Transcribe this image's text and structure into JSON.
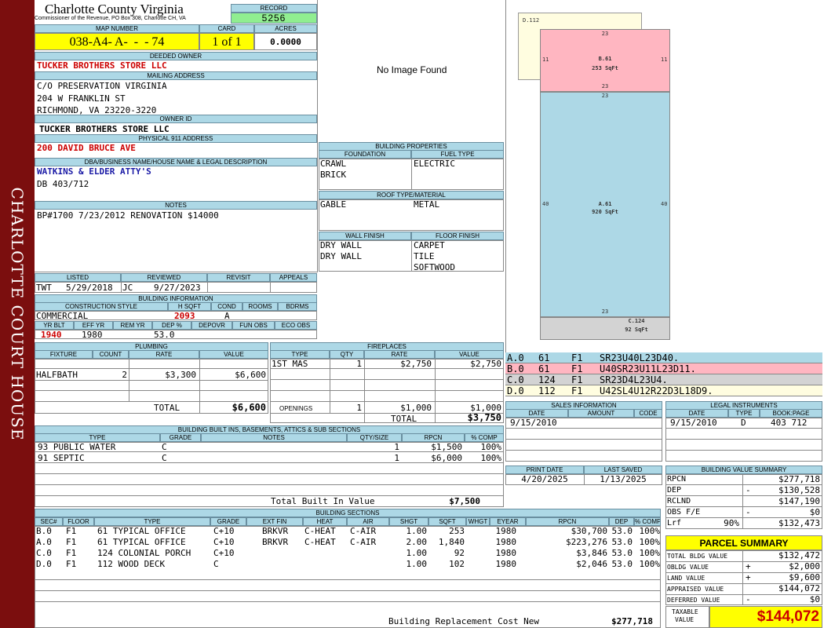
{
  "sidebar": {
    "title": "CHARLOTTE COURT HOUSE"
  },
  "header": {
    "county": "Charlotte County Virginia",
    "office": "Commissioner of the Revenue, PO Box 308, Charlotte CH, VA",
    "record_label": "RECORD",
    "record": "5256",
    "map_number_label": "MAP NUMBER",
    "map_number": "038-A4- A-  -  - 74",
    "card_label": "CARD",
    "card": "1 of 1",
    "acres_label": "ACRES",
    "acres": "0.0000"
  },
  "owner": {
    "deeded_owner_label": "DEEDED OWNER",
    "deeded_owner": "TUCKER BROTHERS STORE LLC",
    "mailing_label": "MAILING ADDRESS",
    "mailing": [
      "C/O PRESERVATION VIRGINIA",
      "204 W FRANKLIN ST",
      "RICHMOND, VA 23220-3220"
    ],
    "owner_id_label": "OWNER ID",
    "owner_id": "TUCKER BROTHERS STORE LLC",
    "physical_label": "PHYSICAL 911 ADDRESS",
    "physical": "200 DAVID BRUCE AVE",
    "dba_label": "DBA/BUSINESS NAME/HOUSE NAME & LEGAL DESCRIPTION",
    "dba": "WATKINS & ELDER ATTY'S",
    "legal": "DB 403/712",
    "notes_label": "NOTES",
    "notes": "BP#1700 7/23/2012 RENOVATION $14000"
  },
  "photo": {
    "placeholder": "No Image Found"
  },
  "building_properties": {
    "title": "BUILDING PROPERTIES",
    "foundation_label": "FOUNDATION",
    "foundation": [
      "CRAWL",
      "BRICK"
    ],
    "fuel_label": "FUEL TYPE",
    "fuel": [
      "ELECTRIC"
    ],
    "roof_label": "ROOF TYPE/MATERIAL",
    "roof_type": "GABLE",
    "roof_material": "METAL",
    "wall_label": "WALL FINISH",
    "wall": [
      "DRY WALL",
      "DRY WALL"
    ],
    "floor_label": "FLOOR FINISH",
    "floor": [
      "CARPET",
      "TILE",
      "SOFTWOOD"
    ]
  },
  "review": {
    "listed_label": "LISTED",
    "reviewed_label": "REVIEWED",
    "revisit_label": "REVISIT",
    "appeals_label": "APPEALS",
    "listed_by": "TWT",
    "listed_date": "5/29/2018",
    "reviewed_by": "JC",
    "reviewed_date": "9/27/2023"
  },
  "building_info": {
    "title": "BUILDING INFORMATION",
    "construction_label": "CONSTRUCTION STYLE",
    "hsqft_label": "H SQFT",
    "cond_label": "COND",
    "rooms_label": "ROOMS",
    "bdrms_label": "BDRMS",
    "construction": "COMMERCIAL",
    "hsqft": "2093",
    "cond": "A",
    "yrblt_label": "YR BLT",
    "effyr_label": "EFF YR",
    "remyr_label": "REM YR",
    "dep_label": "DEP %",
    "depovr_label": "DEPOVR",
    "funobs_label": "FUN OBS",
    "ecoobs_label": "ECO OBS",
    "yrblt": "1940",
    "effyr": "1980",
    "dep": "53.0"
  },
  "plumbing": {
    "title": "PLUMBING",
    "headers": [
      "FIXTURE",
      "COUNT",
      "RATE",
      "VALUE"
    ],
    "fixture": "HALFBATH",
    "count": "2",
    "rate": "$3,300",
    "value": "$6,600",
    "total_label": "TOTAL",
    "total": "$6,600"
  },
  "fireplaces": {
    "title": "FIREPLACES",
    "headers": [
      "TYPE",
      "QTY",
      "RATE",
      "VALUE"
    ],
    "type": "1ST MAS",
    "qty": "1",
    "rate": "$2,750",
    "value": "$2,750",
    "openings_label": "OPENINGS",
    "openings_qty": "1",
    "openings_rate": "$1,000",
    "openings_value": "$1,000",
    "total_label": "TOTAL",
    "total": "$3,750"
  },
  "built_ins": {
    "title": "BUILDING BUILT INS, BASEMENTS, ATTICS & SUB SECTIONS",
    "headers": [
      "TYPE",
      "GRADE",
      "NOTES",
      "QTY/SIZE",
      "RPCN",
      "% COMP"
    ],
    "rows": [
      {
        "type": "93 PUBLIC WATER",
        "grade": "C",
        "qty": "1",
        "rpcn": "$1,500",
        "comp": "100%"
      },
      {
        "type": "91 SEPTIC",
        "grade": "C",
        "qty": "1",
        "rpcn": "$6,000",
        "comp": "100%"
      }
    ],
    "total_label": "Total Built In Value",
    "total": "$7,500"
  },
  "sections": {
    "title": "BUILDING SECTIONS",
    "headers": [
      "SEC#",
      "FLOOR",
      "TYPE",
      "GRADE",
      "EXT FIN",
      "HEAT",
      "AIR",
      "SHGT",
      "SQFT",
      "WHGT",
      "EYEAR",
      "RPCN",
      "DEP",
      "% COMP"
    ],
    "rows": [
      {
        "sec": "B.0",
        "floor": "F1",
        "type": "61 TYPICAL OFFICE",
        "grade": "C+10",
        "ext": "BRKVR",
        "heat": "C-HEAT",
        "air": "C-AIR",
        "shgt": "1.00",
        "sqft": "253",
        "eyear": "1980",
        "rpcn": "$30,700",
        "dep": "53.0",
        "comp": "100%"
      },
      {
        "sec": "A.0",
        "floor": "F1",
        "type": "61 TYPICAL OFFICE",
        "grade": "C+10",
        "ext": "BRKVR",
        "heat": "C-HEAT",
        "air": "C-AIR",
        "shgt": "2.00",
        "sqft": "1,840",
        "eyear": "1980",
        "rpcn": "$223,276",
        "dep": "53.0",
        "comp": "100%"
      },
      {
        "sec": "C.0",
        "floor": "F1",
        "type": "124 COLONIAL PORCH",
        "grade": "C+10",
        "ext": "",
        "heat": "",
        "air": "",
        "shgt": "1.00",
        "sqft": "92",
        "eyear": "1980",
        "rpcn": "$3,846",
        "dep": "53.0",
        "comp": "100%"
      },
      {
        "sec": "D.0",
        "floor": "F1",
        "type": "112 WOOD DECK",
        "grade": "C",
        "ext": "",
        "heat": "",
        "air": "",
        "shgt": "1.00",
        "sqft": "102",
        "eyear": "1980",
        "rpcn": "$2,046",
        "dep": "53.0",
        "comp": "100%"
      }
    ],
    "total_label": "Building Replacement Cost New",
    "total": "$277,718"
  },
  "sketch": {
    "d_label": "D.112",
    "b_label": "B.61",
    "b_area": "253 SqFt",
    "a_label": "A.61",
    "a_area": "920 SqFt",
    "c_label": "C.124",
    "c_area": "92 SqFt",
    "dim_23": "23",
    "dim_11": "11",
    "dim_40": "40",
    "colors": {
      "a": "#add8e6",
      "b": "#ffb6c1",
      "c": "#d3d3d3",
      "d": "#fffde0"
    }
  },
  "sketch_codes": [
    {
      "sec": "A.0",
      "code": "61",
      "floor": "F1",
      "vectors": "SR23U40L23D40."
    },
    {
      "sec": "B.0",
      "code": "61",
      "floor": "F1",
      "vectors": "U40SR23U11L23D11."
    },
    {
      "sec": "C.0",
      "code": "124",
      "floor": "F1",
      "vectors": "SR23D4L23U4."
    },
    {
      "sec": "D.0",
      "code": "112",
      "floor": "F1",
      "vectors": "U42SL4U12R22D3L18D9."
    }
  ],
  "sales": {
    "title": "SALES INFORMATION",
    "date_label": "DATE",
    "amount_label": "AMOUNT",
    "code_label": "CODE",
    "date": "9/15/2010"
  },
  "legal_instruments": {
    "title": "LEGAL INSTRUMENTS",
    "date_label": "DATE",
    "type_label": "TYPE",
    "book_label": "BOOK:PAGE",
    "date": "9/15/2010",
    "type": "D",
    "book": "403 712"
  },
  "dates": {
    "print_label": "PRINT DATE",
    "print": "4/20/2025",
    "saved_label": "LAST SAVED",
    "saved": "1/13/2025"
  },
  "value_summary": {
    "title": "BUILDING VALUE SUMMARY",
    "rpcn_label": "RPCN",
    "rpcn": "$277,718",
    "dep_label": "DEP",
    "dep_sign": "-",
    "dep": "$130,528",
    "rclnd_label": "RCLND",
    "rclnd": "$147,190",
    "obs_label": "OBS F/E",
    "obs_sign": "-",
    "obs": "$0",
    "lrf_label": "Lrf",
    "lrf_pct": "90%",
    "lrf": "$132,473"
  },
  "parcel_summary": {
    "title": "PARCEL SUMMARY",
    "total_bldg_label": "TOTAL BLDG VALUE",
    "total_bldg": "$132,472",
    "obldg_label": "OBLDG VALUE",
    "obldg_sign": "+",
    "obldg": "$2,000",
    "land_label": "LAND VALUE",
    "land_sign": "+",
    "land": "$9,600",
    "appraised_label": "APPRAISED VALUE",
    "appraised": "$144,072",
    "deferred_label": "DEFERRED VALUE",
    "deferred_sign": "-",
    "deferred": "$0",
    "taxable_label_1": "TAXABLE",
    "taxable_label_2": "VALUE",
    "taxable": "$144,072"
  }
}
